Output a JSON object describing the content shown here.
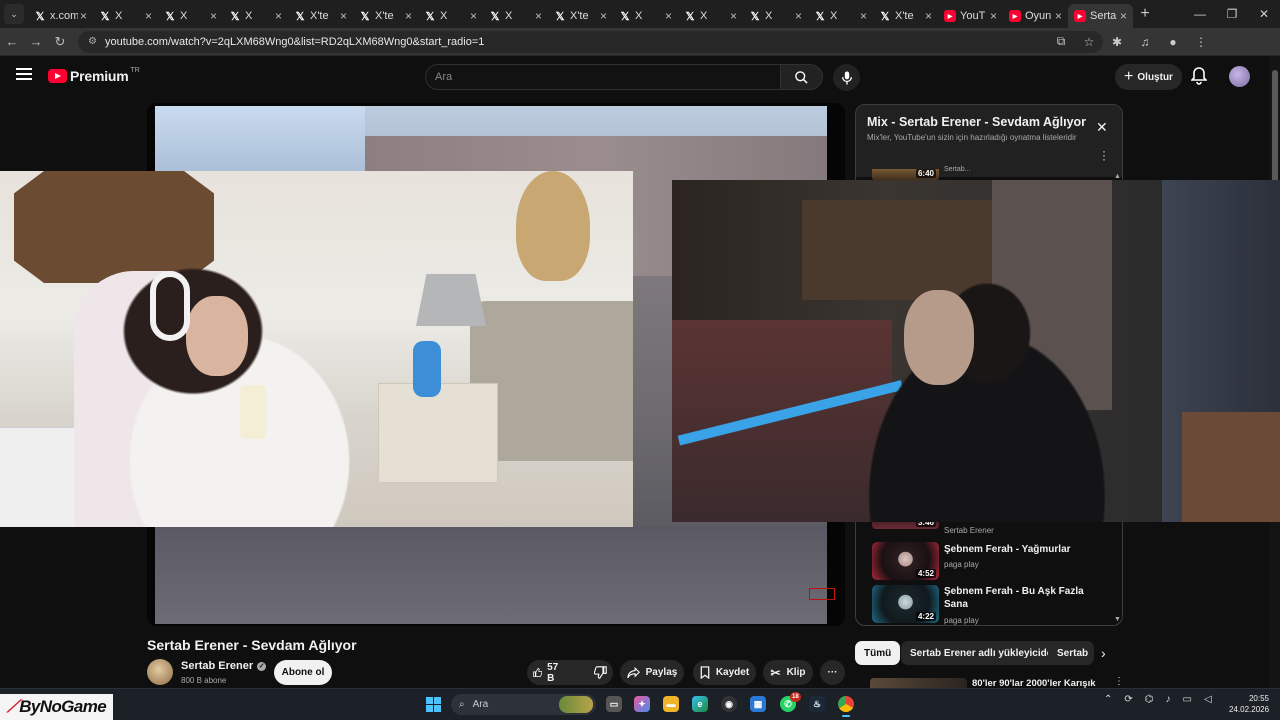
{
  "browser": {
    "tabs": [
      {
        "label": "x.com",
        "icon": "x-icon"
      },
      {
        "label": "X",
        "icon": "x-icon"
      },
      {
        "label": "X",
        "icon": "x-icon"
      },
      {
        "label": "X",
        "icon": "x-icon"
      },
      {
        "label": "X'te",
        "icon": "x-icon"
      },
      {
        "label": "X'te",
        "icon": "x-icon"
      },
      {
        "label": "X",
        "icon": "x-icon"
      },
      {
        "label": "X",
        "icon": "x-icon"
      },
      {
        "label": "X'te",
        "icon": "x-icon"
      },
      {
        "label": "X",
        "icon": "x-icon"
      },
      {
        "label": "X",
        "icon": "x-icon"
      },
      {
        "label": "X",
        "icon": "x-icon"
      },
      {
        "label": "X",
        "icon": "x-icon"
      },
      {
        "label": "X'te",
        "icon": "x-icon"
      },
      {
        "label": "YouT",
        "icon": "youtube-icon"
      },
      {
        "label": "Oyun",
        "icon": "youtube-icon"
      },
      {
        "label": "Serta",
        "icon": "youtube-icon",
        "active": true
      }
    ],
    "url": "youtube.com/watch?v=2qLXM68Wng0&list=RD2qLXM68Wng0&start_radio=1"
  },
  "header": {
    "logo": "Premium",
    "region": "TR",
    "search_placeholder": "Ara",
    "create_label": "Oluştur"
  },
  "video": {
    "title": "Sertab Erener - Sevdam Ağlıyor",
    "channel": "Sertab Erener",
    "subscribers": "800 B abone",
    "subscribe_label": "Abone ol",
    "likes": "57 B",
    "share_label": "Paylaş",
    "save_label": "Kaydet",
    "clip_label": "Klip"
  },
  "mix": {
    "title": "Mix - Sertab Erener - Sevdam Ağlıyor",
    "subtitle": "Mix'ler, YouTube'un sizin için hazırladığı oynatma listeleridir",
    "items": [
      {
        "duration": "6:40",
        "title": "",
        "channel": "Sertab..."
      },
      {
        "duration": "3:46",
        "title": "",
        "channel": "Sertab Erener"
      },
      {
        "duration": "4:52",
        "title": "Şebnem Ferah - Yağmurlar",
        "channel": "paga play"
      },
      {
        "duration": "4:22",
        "title": "Şebnem Ferah - Bu Aşk Fazla Sana",
        "channel": "paga play"
      }
    ]
  },
  "chips": [
    "Tümü",
    "Sertab Erener adlı yükleyiciden",
    "Sertab"
  ],
  "recommendation": {
    "title": "80'ler 90'lar 2000'ler Karışık"
  },
  "overlay": {
    "brand": "ByNoGame"
  },
  "taskbar": {
    "search_label": "Ara",
    "whatsapp_badge": "18",
    "time": "20:55",
    "date": "24.02.2026"
  }
}
